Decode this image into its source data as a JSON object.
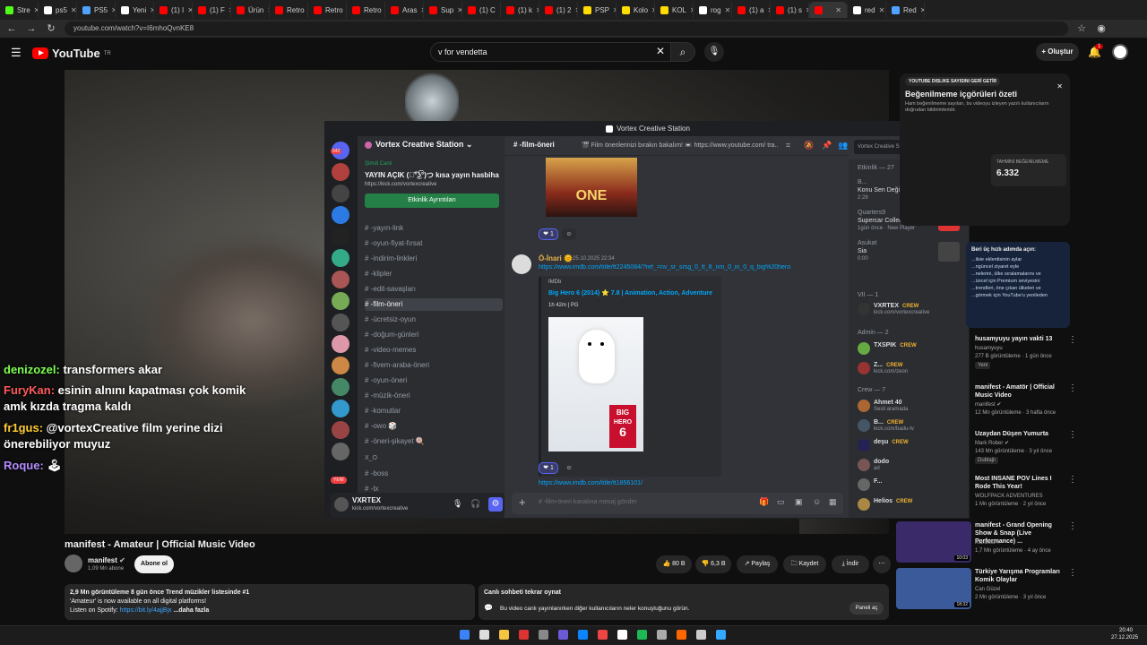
{
  "browser": {
    "tabs": [
      {
        "label": "Stre",
        "color": "#53fc18"
      },
      {
        "label": "ps5",
        "color": "#ffffff"
      },
      {
        "label": "PS5",
        "color": "#4fa3ff"
      },
      {
        "label": "Yeni",
        "color": "#ffffff"
      },
      {
        "label": "(1) I",
        "color": "#ff0000"
      },
      {
        "label": "(1) F",
        "color": "#ff0000"
      },
      {
        "label": "Ürün",
        "color": "#ff0000"
      },
      {
        "label": "Retro",
        "color": "#ff0000"
      },
      {
        "label": "Retro",
        "color": "#ff0000"
      },
      {
        "label": "Retro",
        "color": "#ff0000"
      },
      {
        "label": "Aras",
        "color": "#ff0000"
      },
      {
        "label": "Sup",
        "color": "#ff0000"
      },
      {
        "label": "(1) C",
        "color": "#ff0000"
      },
      {
        "label": "(1) k",
        "color": "#ff0000"
      },
      {
        "label": "(1) 2",
        "color": "#ff0000"
      },
      {
        "label": "PSP",
        "color": "#ffdd00"
      },
      {
        "label": "Kolo",
        "color": "#ffdd00"
      },
      {
        "label": "KOL",
        "color": "#ffdd00"
      },
      {
        "label": "rog",
        "color": "#ffffff"
      },
      {
        "label": "(1) a",
        "color": "#ff0000"
      },
      {
        "label": "(1) s",
        "color": "#ff0000"
      },
      {
        "label": "",
        "color": "#ff0000"
      },
      {
        "label": "red",
        "color": "#ffffff"
      },
      {
        "label": "Red",
        "color": "#4fa3ff"
      }
    ],
    "url": "youtube.com/watch?v=I6mhoQvnKE8"
  },
  "youtube": {
    "logo": "YouTube",
    "logo_region": "TR",
    "search_value": "v for vendetta",
    "create_label": "Oluştur",
    "notif_count": "1"
  },
  "video_overlay_chat": [
    {
      "user": "denizozel:",
      "text": " transformers akar",
      "color": "#7cff4f"
    },
    {
      "user": "FuryKan:",
      "text": " esinin alnını kapatması çok komik amk kızda tragma kaldı",
      "color": "#ff5a5a"
    },
    {
      "user": "fr1gus:",
      "text": " @vortexCreative film yerine dizi önerebiliyor muyuz",
      "color": "#ffcc33"
    },
    {
      "user": "Roque:",
      "text": " 🕹",
      "color": "#b38cff"
    }
  ],
  "discord": {
    "window_title": "Vortex Creative Station",
    "server_name": "Vortex Creative Station",
    "live_badge": "Şimdi Canlı",
    "live_title": "YAYIN AÇIK (つ͡°͜ʖ͡°)つ kısa yayın hasbihal",
    "live_link": "https://kick.com/vortexcreative",
    "event_button": "Etkinlik Ayrıntıları",
    "guild_badge": "542",
    "new_badge": "YENİ",
    "channels": [
      "-yayın-link",
      "-oyun-fiyat-fırsat",
      "-indirim-linkleri",
      "-klipler",
      "-edit-savaşları",
      "-film-öneri",
      "-ücretsiz-oyun",
      "-doğum-günleri",
      "-video-memes",
      "-fivem-araba-öneri",
      "-oyun-öneri",
      "-müzik-öneri",
      "-komutlar",
      "-owo 🎲",
      "-öneri-şikayet 🍭"
    ],
    "category": "X_O",
    "extra_channels": [
      "-boss",
      "-tx"
    ],
    "user": {
      "name": "VXRTEX",
      "status": "kick.com/vortexcreative"
    },
    "channel_header": {
      "name": "-film-öneri",
      "topic": "🎬 Film önerilerinizi bırakın bakalım! 📼 https://www.youtube.com/ tra..."
    },
    "search_placeholder": "Vortex Creative Station sunucus...",
    "message": {
      "author": "Ö-İnari 🌞",
      "time": "25.10.2025 22:34",
      "link": "https://www.imdb.com/title/tt2245084/?ref_=nv_sr_srsg_0_tt_8_nm_0_in_0_q_big%20hero",
      "embed_site": "IMDb",
      "embed_title": "Big Hero 6 (2014) ⭐ 7.8 | Animation, Action, Adventure",
      "embed_desc": "1h 42m | PG",
      "poster_text_top": "BIG",
      "poster_text_mid": "HERO",
      "poster_text_num": "6",
      "reaction_count": "1",
      "prev_reaction_count": "1",
      "next_link": "https://www.imdb.com/title/tt1856101/"
    },
    "prev_poster_text": "ONE",
    "composer_placeholder": "#  -film-öneri kanalına mesaj gönder",
    "members": {
      "events_header": "Etkinlik — 27",
      "events": [
        {
          "name": "B...",
          "sub": "Konu Sen Değilsin",
          "meta": "2:28"
        },
        {
          "name": "Quarters9",
          "sub": "Supercar Collection Simul...",
          "meta": "1gün önce · New Player"
        },
        {
          "name": "Asukat",
          "sub": "Sia",
          "meta": "0:00"
        }
      ],
      "vip_header": "VII — 1",
      "vip": [
        {
          "name": "VXRTEX",
          "tag": "CREW",
          "sub": "kick.com/vortexcreative"
        }
      ],
      "admin_header": "Admin — 2",
      "admins": [
        {
          "name": "TXSPIK",
          "tag": "CREW",
          "sub": ""
        },
        {
          "name": "Z...",
          "tag": "CREW",
          "sub": "kick.com/zeon"
        }
      ],
      "crew_header": "Crew — 7",
      "crew": [
        {
          "name": "Ahmet 40",
          "tag": "",
          "sub": "Sesli aramada"
        },
        {
          "name": "B...",
          "tag": "CREW",
          "sub": "kick.com/badu-tv"
        },
        {
          "name": "deşu",
          "tag": "CREW",
          "sub": ""
        },
        {
          "name": "dodo",
          "tag": "",
          "sub": "ad"
        },
        {
          "name": "F...",
          "tag": "",
          "sub": ""
        },
        {
          "name": "Helios",
          "tag": "CREW",
          "sub": ""
        }
      ]
    }
  },
  "dislike_panel": {
    "badge": "YOUTUBE DISLIKE SAYISINI GERİ GETİR",
    "title": "Beğenilmeme içgörüleri özeti",
    "desc": "Ham beğenilmeme sayıları, bu videoyu izleyen yazılı kullanıcıların doğrudan bildirimleridir.",
    "stat_label": "TAHMİNİ BEĞENİLMEME",
    "stat_value": "6.332",
    "tip_title": "Beri üç hızlı adımda açın:",
    "tip_lines": [
      "...ilsie eklentisinin aylar",
      "...ngüncel ziyaret eyle",
      "...nelerini, ülke sıralamalarını ve",
      "...üncel için Premium seviyesini",
      "...trendleri, öne çıkan ülkeleri ve",
      "...görmek için YouTube'u yenileden"
    ]
  },
  "recommendations": [
    {
      "title": "husamyuyu yayın vakti 13",
      "channel": "husamyuyu",
      "meta": "277 B görüntüleme · 1 gün önce",
      "badge": "Yeni",
      "duration": "",
      "thumb": "#2a2a2a"
    },
    {
      "title": "manifest - Amatör | Official Music Video",
      "channel": "manifest ✔",
      "meta": "12 Mn görüntüleme · 3 hafta önce",
      "badge": "",
      "duration": "",
      "thumb": "#2a2a2a"
    },
    {
      "title": "Uzaydan Düşen Yumurta",
      "channel": "Mark Rober ✔",
      "meta": "143 Mn görüntüleme · 3 yıl önce",
      "badge": "Dublajlı",
      "duration": "",
      "thumb": "#2a2a2a"
    },
    {
      "title": "Most INSANE POV Lines I Rode This Year!",
      "channel": "WOLFPACK ADVENTURES",
      "meta": "1 Mn görüntüleme · 2 yıl önce",
      "badge": "",
      "duration": "",
      "thumb": "#2a2a2a"
    },
    {
      "title": "manifest - Grand Opening Show & Snap (Live Performance) ...",
      "channel": "manifest ✔",
      "meta": "1,7 Mn görüntüleme · 4 ay önce",
      "badge": "",
      "duration": "10:03",
      "thumb": "#3a2a6a"
    },
    {
      "title": "Türkiye Yarışma Programları Komik Olaylar",
      "channel": "Can Güzel",
      "meta": "2 Mn görüntüleme · 3 yıl önce",
      "badge": "",
      "duration": "18:32",
      "thumb": "#3a5a9a"
    }
  ],
  "watch": {
    "title": "manifest - Amateur | Official Music Video",
    "channel": "manifest",
    "subs": "1,09 Mn abone",
    "subscribe": "Abone ol",
    "likes": "80 B",
    "dislikes": "6,3 B",
    "share": "Paylaş",
    "save": "Kaydet",
    "download": "İndir",
    "desc_stats": "2,9 Mn görüntüleme  8 gün önce  Trend müzikler listesinde #1",
    "desc_line1": "'Amateur' is now available on all digital platforms!",
    "desc_line2": "Listen on Spotify: ",
    "desc_link": "https://bit.ly/4ajjBjx",
    "desc_more": "...daha fazla",
    "chat_replay_title": "Canlı sohbeti tekrar oynat",
    "chat_replay_desc": "Bu video canlı yayınlanırken diğer kullanıcıların neler konuştuğunu görün.",
    "chat_replay_btn": "Paneli aç"
  },
  "taskbar": {
    "time": "20:40",
    "date": "27.12.2025"
  }
}
